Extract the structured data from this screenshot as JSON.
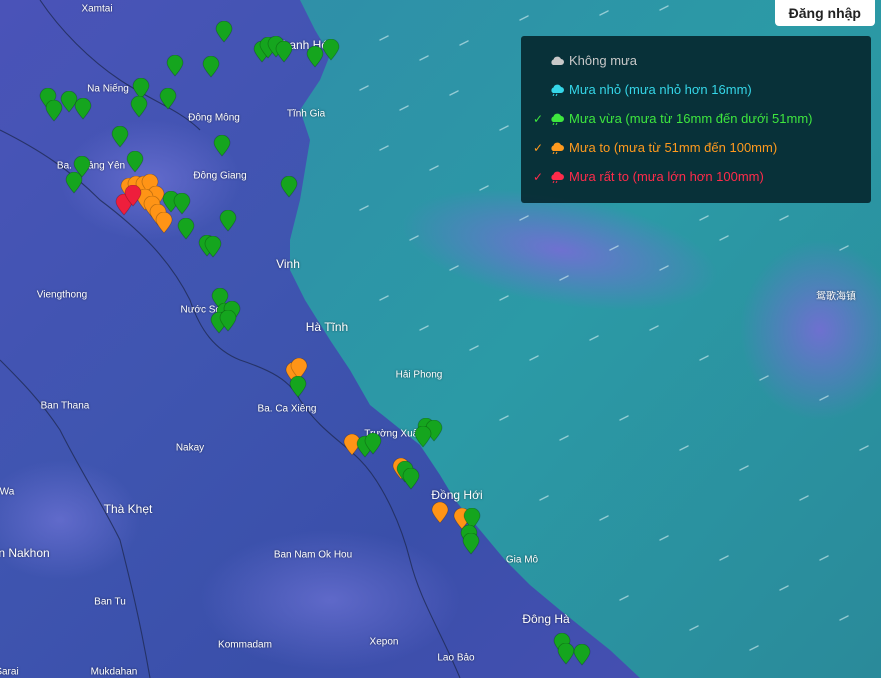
{
  "header": {
    "login_label": "Đăng nhập"
  },
  "legend": {
    "items": [
      {
        "label": "Không mưa",
        "color": "#c8c8c8",
        "checked": false,
        "icon": "cloud-icon"
      },
      {
        "label": "Mưa nhỏ (mưa nhỏ hơn 16mm)",
        "color": "#35d6e8",
        "checked": false,
        "icon": "rain-cloud-icon"
      },
      {
        "label": "Mưa vừa (mưa từ 16mm đến dưới 51mm)",
        "color": "#3ee63e",
        "checked": true,
        "check": "✓",
        "icon": "rain-cloud-icon"
      },
      {
        "label": "Mưa to (mưa từ 51mm đến 100mm)",
        "color": "#ff9a1e",
        "checked": true,
        "check": "✓",
        "icon": "rain-cloud-icon"
      },
      {
        "label": "Mưa rất to (mưa lớn hơn 100mm)",
        "color": "#ff2b4a",
        "checked": true,
        "check": "✓",
        "icon": "rain-cloud-icon"
      }
    ]
  },
  "places": [
    {
      "name": "Xamtai"
    },
    {
      "name": "Thanh Hóa"
    },
    {
      "name": "Na Niếng"
    },
    {
      "name": "Đông Mông"
    },
    {
      "name": "Tĩnh Gia"
    },
    {
      "name": "Ba. Quảng Yên"
    },
    {
      "name": "Đông Giang"
    },
    {
      "name": "Vinh"
    },
    {
      "name": "Viengthong"
    },
    {
      "name": "Nước Sơn"
    },
    {
      "name": "Hà Tĩnh"
    },
    {
      "name": "鸳歌海镇"
    },
    {
      "name": "Hải Phong"
    },
    {
      "name": "Ban Thana"
    },
    {
      "name": "Ba. Ca Xiêng"
    },
    {
      "name": "Trường Xuân"
    },
    {
      "name": "Nakay"
    },
    {
      "name": "Wa"
    },
    {
      "name": "Đồng Hới"
    },
    {
      "name": "Thà Khẹt"
    },
    {
      "name": "n Nakhon"
    },
    {
      "name": "Ban Nam Ok Hou"
    },
    {
      "name": "Gia Mô"
    },
    {
      "name": "Ban Tu"
    },
    {
      "name": "Đông Hà"
    },
    {
      "name": "Kommadam"
    },
    {
      "name": "Xepon"
    },
    {
      "name": "Lao Bảo"
    },
    {
      "name": "Mukdahan"
    },
    {
      "name": "Sarai"
    }
  ],
  "rain_levels": {
    "green": "#15a51e",
    "orange": "#ff9416",
    "red": "#ee1e3c"
  },
  "stations": [
    {
      "level": "green",
      "count_hint": 1
    },
    {
      "level": "orange",
      "count_hint": 1
    },
    {
      "level": "red",
      "count_hint": 1
    }
  ]
}
